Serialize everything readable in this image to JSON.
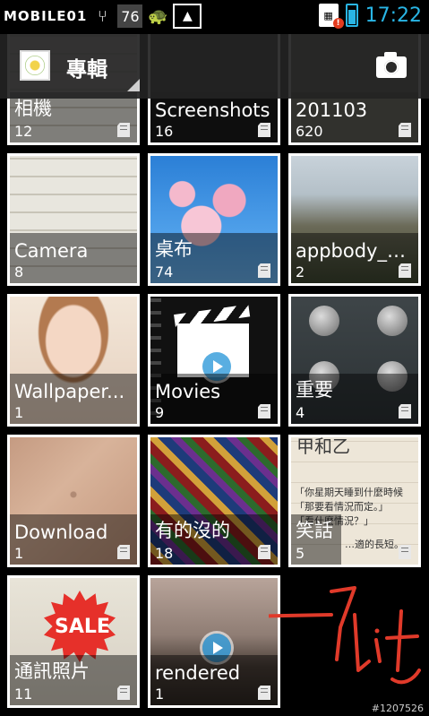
{
  "status_bar": {
    "brand": "MOBILE01",
    "notification_number": "76",
    "time": "17:22",
    "sim_badge": "!",
    "battery_level": 0.75
  },
  "action_bar": {
    "title": "專輯",
    "icons": {
      "album": "album-thumbnail-icon",
      "camera": "camera-icon"
    }
  },
  "albums": [
    {
      "name": "相機",
      "count": "12",
      "storage": "sd-card-icon"
    },
    {
      "name": "Screenshots",
      "count": "16",
      "storage": "sd-card-icon"
    },
    {
      "name": "201103",
      "count": "620",
      "storage": "sd-card-icon"
    },
    {
      "name": "Camera",
      "count": "8",
      "storage": "none"
    },
    {
      "name": "桌布",
      "count": "74",
      "storage": "sd-card-icon"
    },
    {
      "name": "appbody_p...",
      "count": "2",
      "storage": "sd-card-icon"
    },
    {
      "name": "Wallpaper...",
      "count": "1",
      "storage": "none"
    },
    {
      "name": "Movies",
      "count": "9",
      "storage": "sd-card-icon"
    },
    {
      "name": "重要",
      "count": "4",
      "storage": "sd-card-icon"
    },
    {
      "name": "Download",
      "count": "1",
      "storage": "sd-card-icon"
    },
    {
      "name": "有的沒的",
      "count": "18",
      "storage": "sd-card-icon"
    },
    {
      "name": "笑話",
      "count": "5",
      "storage": "sd-card-icon"
    },
    {
      "name": "通訊照片",
      "count": "11",
      "storage": "sd-card-icon"
    },
    {
      "name": "rendered",
      "count": "1",
      "storage": "sd-card-icon"
    }
  ],
  "thumbnail_text": {
    "sale": "SALE",
    "paper_lines": [
      "甲和乙",
      "「你星期天睡到什麼時候",
      "「那要看情況而定。」",
      "「看什麼情況？」",
      "…適的長短。"
    ]
  },
  "annotation": {
    "handwriting": "7Lit"
  },
  "watermark": "#1207526",
  "colors": {
    "accent": "#29b6e6",
    "tile_border": "#ffffff",
    "background": "#000000"
  }
}
